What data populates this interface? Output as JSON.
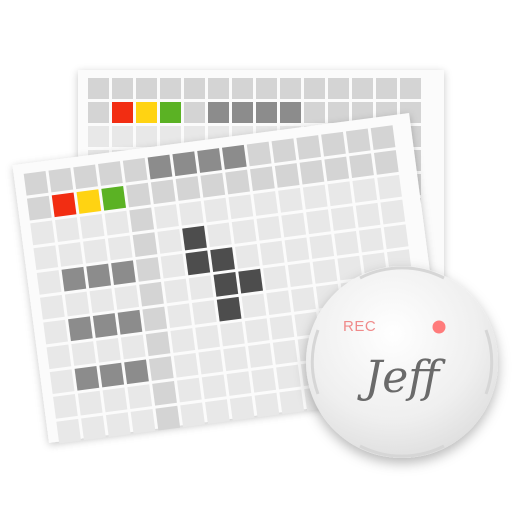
{
  "icon": {
    "name": "Jeff",
    "rec_label": "REC",
    "wordmark": "Jeff"
  },
  "colors": {
    "sheet_bg": "#fbfbfb",
    "cell_light": "#e8e8e8",
    "cell_medium": "#d4d4d4",
    "cell_dark": "#8c8c8c",
    "cell_darker": "#4d4d4d",
    "red": "#f22d12",
    "yellow": "#ffd312",
    "green": "#5bb224",
    "rec_text": "#f08a8a",
    "rec_dot": "#ff7b7b",
    "knob": "#efefef",
    "wordmark_ink": "#6a6a6a"
  },
  "icons": [
    "back-sheet-grid",
    "front-sheet-grid",
    "traffic-light-cells",
    "record-knob-icon",
    "record-dot-icon"
  ]
}
